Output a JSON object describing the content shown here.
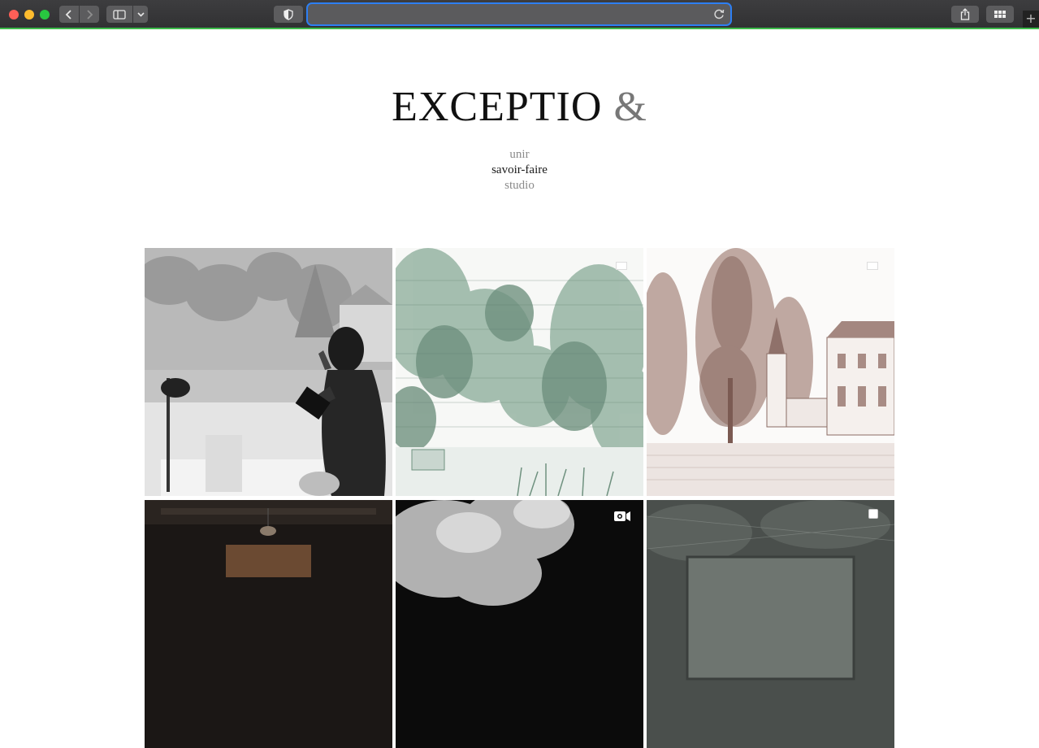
{
  "browser": {
    "url": "",
    "colors": {
      "focus_ring": "#2d7ff3",
      "progress": "#3dbb4a"
    }
  },
  "site": {
    "logo_text": "EXCEPTIO",
    "logo_amp": "&",
    "nav": [
      {
        "label": "unir",
        "active": false
      },
      {
        "label": "savoir-faire",
        "active": true
      },
      {
        "label": "studio",
        "active": false
      }
    ]
  },
  "gallery": {
    "items": [
      {
        "subject": "woman drawing on tablet in studio, monochrome",
        "badge": "none"
      },
      {
        "subject": "green engraved trees illustration",
        "badge": "carousel-icon"
      },
      {
        "subject": "brown engraved chateau illustration",
        "badge": "carousel-icon"
      },
      {
        "subject": "dark interior with lamp",
        "badge": "none"
      },
      {
        "subject": "white smoke on black",
        "badge": "video-icon"
      },
      {
        "subject": "grey marble slab",
        "badge": "carousel-icon"
      }
    ]
  }
}
